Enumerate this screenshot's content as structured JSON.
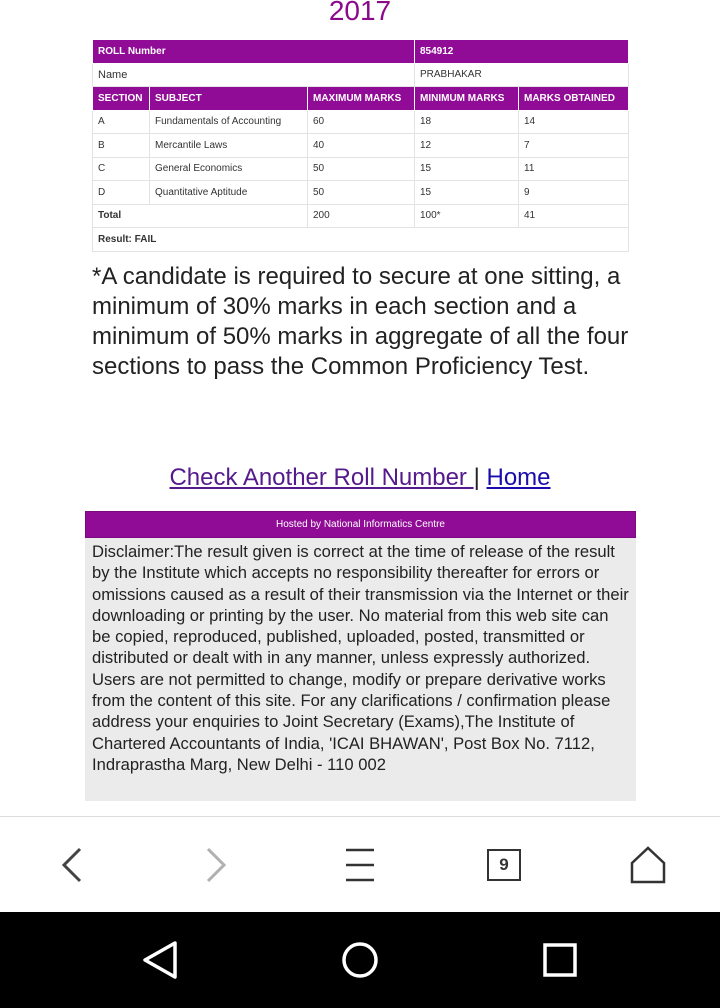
{
  "header": {
    "year": "2017"
  },
  "result": {
    "roll_label": "ROLL Number",
    "roll_value": "854912",
    "name_label": "Name",
    "name_value": "PRABHAKAR",
    "columns": [
      "SECTION",
      "SUBJECT",
      "MAXIMUM MARKS",
      "MINIMUM MARKS",
      "MARKS OBTAINED"
    ],
    "rows": [
      {
        "section": "A",
        "subject": "Fundamentals of Accounting",
        "max": "60",
        "min": "18",
        "obtained": "14"
      },
      {
        "section": "B",
        "subject": "Mercantile Laws",
        "max": "40",
        "min": "12",
        "obtained": "7"
      },
      {
        "section": "C",
        "subject": "General Economics",
        "max": "50",
        "min": "15",
        "obtained": "11"
      },
      {
        "section": "D",
        "subject": "Quantitative Aptitude",
        "max": "50",
        "min": "15",
        "obtained": "9"
      }
    ],
    "total_label": "Total",
    "total_max": "200",
    "total_min": "100*",
    "total_obtained": "41",
    "result_text": "Result: FAIL"
  },
  "note": "*A candidate is required to secure at one sitting, a minimum of 30% marks in each section and a minimum of 50% marks in aggregate of all the four sections to pass the Common Proficiency Test.",
  "links": {
    "check_another": "Check Another Roll Number ",
    "separator": "|",
    "home": "Home"
  },
  "footer": {
    "hosted_by": "Hosted by National Informatics Centre",
    "disclaimer": "Disclaimer:The result given is correct at the time of release of the result by the Institute which accepts no responsibility thereafter for errors or omissions caused as a result of their transmission via the Internet or their downloading or printing by the user. No material from this web site can be copied, reproduced, published, uploaded, posted, transmitted or distributed or dealt with in any manner, unless expressly authorized. Users are not permitted to change, modify or prepare derivative works from the content of this site. For any clarifications / confirmation please address your enquiries to Joint Secretary (Exams),The Institute of Chartered Accountants of India, 'ICAI BHAWAN', Post Box No. 7112, Indraprastha Marg, New Delhi - 110 002"
  },
  "browser_toolbar": {
    "tab_count": "9",
    "icons": [
      "back-icon",
      "forward-icon",
      "menu-icon",
      "tabs-icon",
      "home-icon"
    ]
  },
  "android_nav": {
    "icons": [
      "back-triangle-icon",
      "home-circle-icon",
      "recents-square-icon"
    ]
  },
  "colors": {
    "accent": "#910c96",
    "year": "#8b0a8b",
    "visited_link": "#551a8b",
    "link": "#1a0dab"
  }
}
